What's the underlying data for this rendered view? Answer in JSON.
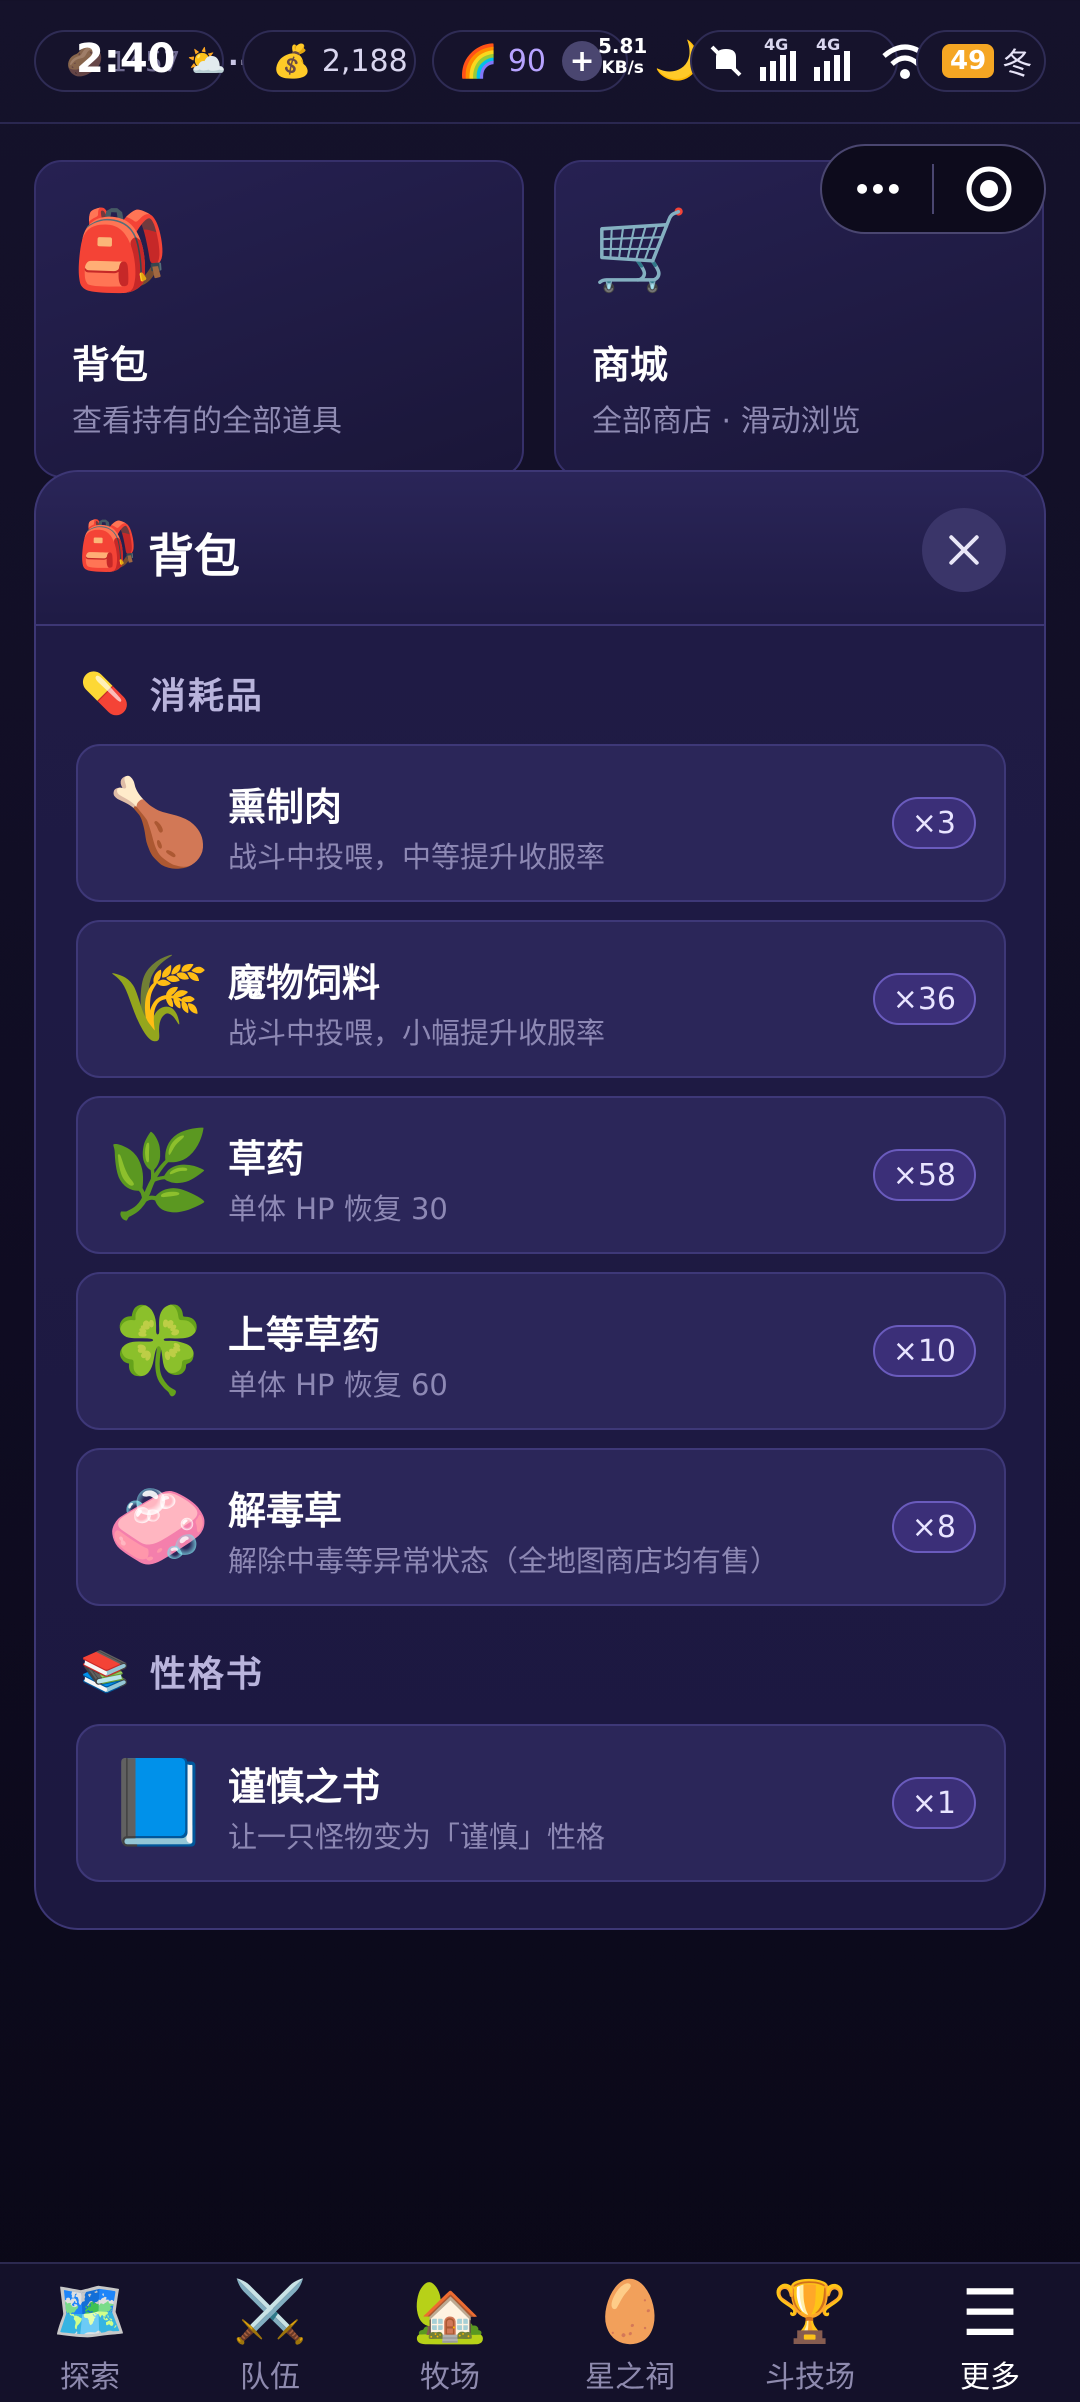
{
  "statusbar": {
    "time": "2:40",
    "resource1_icon": "🥔",
    "resource1_partial": "1457",
    "weather_icon": "⛅",
    "more_dots": "···",
    "coins_icon": "💰",
    "coins": "2,188",
    "rainbow_icon": "🌈",
    "rainbow_value": "90",
    "plus_label": "+",
    "net_speed": "5.81",
    "net_unit": "KB/s",
    "moon_icon": "🌙",
    "network_label_1": "4G",
    "network_label_2": "4G",
    "battery": "49",
    "season": "冬"
  },
  "cards": [
    {
      "icon": "🎒",
      "title": "背包",
      "subtitle": "查看持有的全部道具"
    },
    {
      "icon": "🛒",
      "title": "商城",
      "subtitle": "全部商店 · 滑动浏览"
    }
  ],
  "capsule": {
    "menu_icon": "•••",
    "target_icon": "◉"
  },
  "modal": {
    "icon": "🎒",
    "title": "背包",
    "sections": [
      {
        "icon": "💊",
        "label": "消耗品",
        "items": [
          {
            "icon": "🍗",
            "name": "熏制肉",
            "desc": "战斗中投喂，中等提升收服率",
            "count": "×3"
          },
          {
            "icon": "🌾",
            "name": "魔物饲料",
            "desc": "战斗中投喂，小幅提升收服率",
            "count": "×36"
          },
          {
            "icon": "🌿",
            "name": "草药",
            "desc": "单体 HP 恢复 30",
            "count": "×58"
          },
          {
            "icon": "🍀",
            "name": "上等草药",
            "desc": "单体 HP 恢复 60",
            "count": "×10"
          },
          {
            "icon": "🧼",
            "name": "解毒草",
            "desc": "解除中毒等异常状态（全地图商店均有售）",
            "count": "×8"
          }
        ]
      },
      {
        "icon": "📚",
        "label": "性格书",
        "items": [
          {
            "icon": "📘",
            "name": "谨慎之书",
            "desc": "让一只怪物变为「谨慎」性格",
            "count": "×1"
          }
        ]
      }
    ]
  },
  "bottom_nav": [
    {
      "icon": "🗺️",
      "label": "探索"
    },
    {
      "icon": "⚔️",
      "label": "队伍"
    },
    {
      "icon": "🏡",
      "label": "牧场"
    },
    {
      "icon": "🥚",
      "label": "星之祠"
    },
    {
      "icon": "🏆",
      "label": "斗技场"
    },
    {
      "icon": "☰",
      "label": "更多"
    }
  ],
  "active_nav": "更多"
}
